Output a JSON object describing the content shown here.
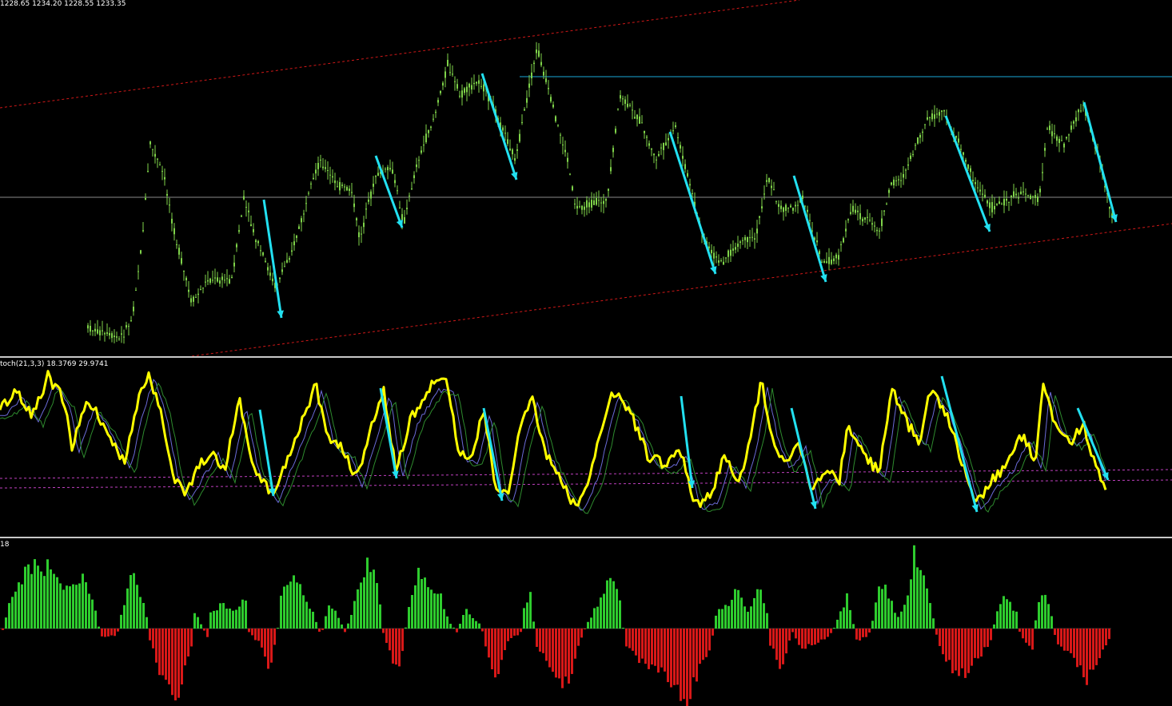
{
  "price_header": "1228.65 1234.20 1228.55 1233.35",
  "stoch_header": "toch(21,3,3) 18.3769 29.9741",
  "hist_header": "18",
  "colors": {
    "background": "#000000",
    "candle": "#7fd34a",
    "channel": "#d01818",
    "resistance": "#1aa7d8",
    "midline": "#8a8a8a",
    "arrow": "#22e0f0",
    "stoch_main": "#ffff00",
    "stoch_signal_a": "#6b6bd8",
    "stoch_signal_b": "#2e8b2e",
    "level": "#c040c0",
    "hist_pos": "#2ecc2e",
    "hist_neg": "#d81818"
  },
  "chart_data": [
    {
      "type": "candlestick",
      "pane": "price",
      "grid": false,
      "annotations": [
        "upper channel",
        "lower channel",
        "resistance line",
        "horizontal midline",
        "down arrows"
      ]
    },
    {
      "type": "line",
      "pane": "stochastic",
      "parameters": [
        21,
        3,
        3
      ],
      "main_value": 18.3769,
      "signal_value": 29.9741,
      "levels": [
        20,
        25
      ]
    },
    {
      "type": "bar",
      "pane": "histogram",
      "zero_line": true
    }
  ]
}
